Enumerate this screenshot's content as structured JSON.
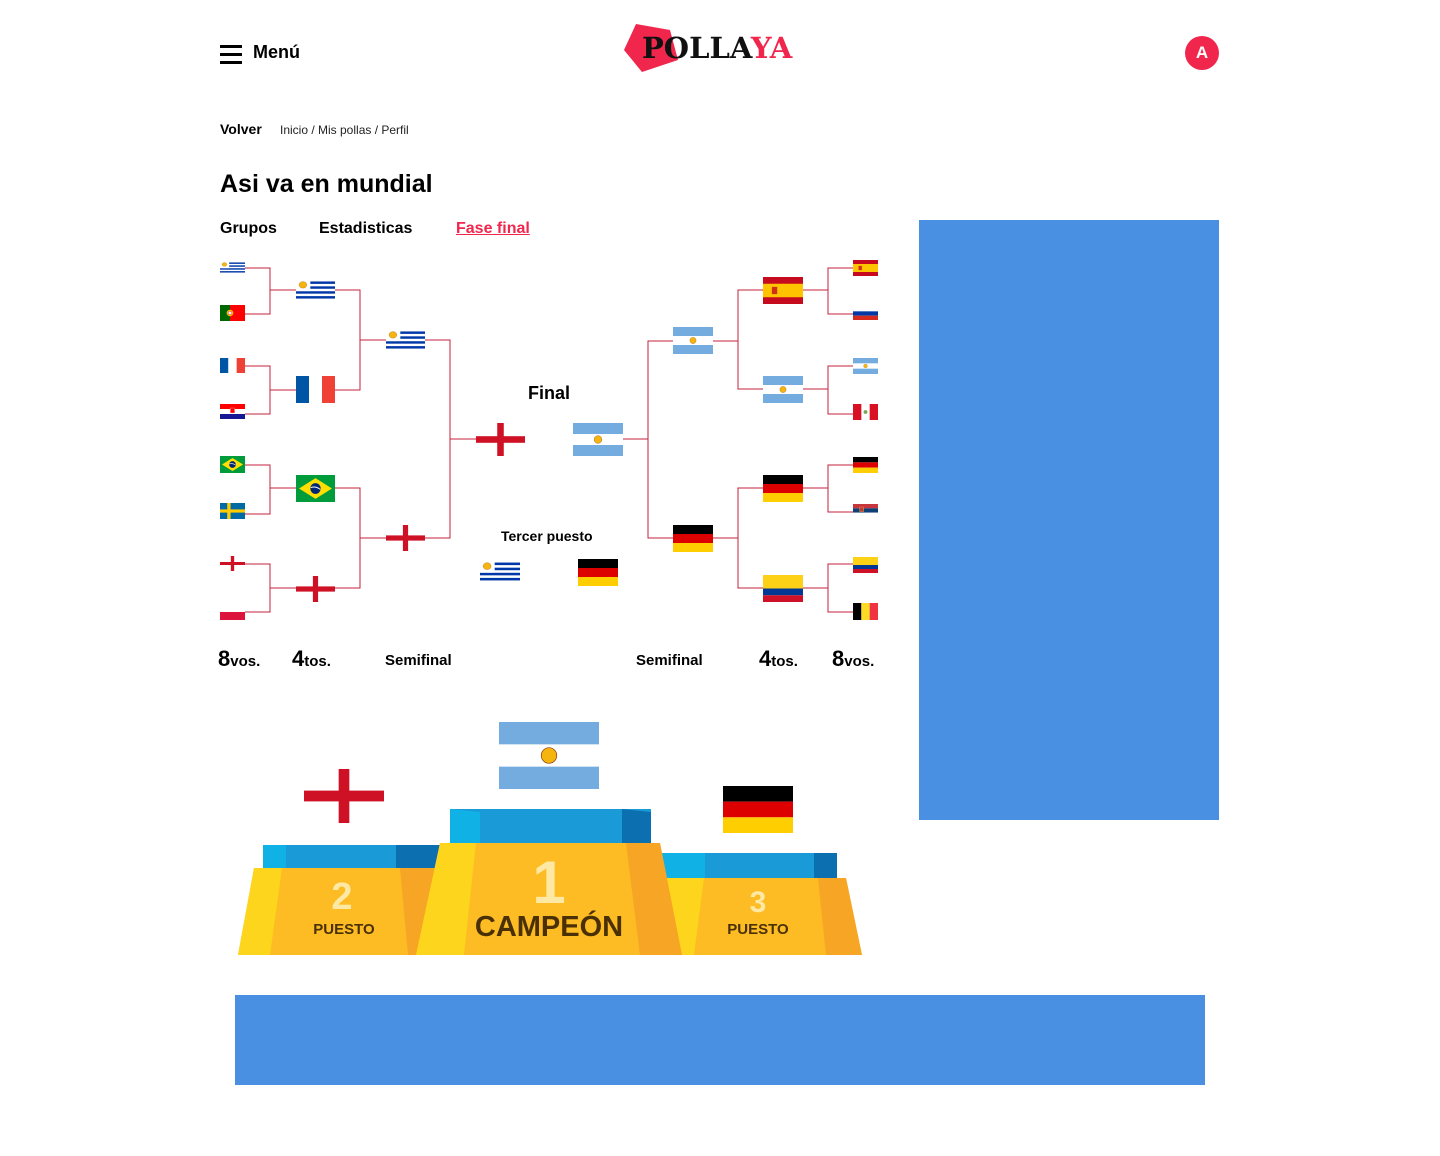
{
  "header": {
    "menu_label": "Menú",
    "logo_part1": "POLLA",
    "logo_part2": "YA",
    "avatar_initial": "A",
    "brand_color": "#f0264d"
  },
  "breadcrumb": {
    "back": "Volver",
    "path": "Inicio / Mis pollas / Perfil"
  },
  "page": {
    "title": "Asi va en mundial"
  },
  "tabs": [
    {
      "label": "Grupos",
      "active": false
    },
    {
      "label": "Estadisticas",
      "active": false
    },
    {
      "label": "Fase final",
      "active": true
    }
  ],
  "bracket": {
    "left_round_of_16": [
      "uruguay",
      "portugal",
      "france",
      "croatia",
      "brazil",
      "sweden",
      "england",
      "poland"
    ],
    "left_quarters": [
      "uruguay",
      "france",
      "brazil",
      "england"
    ],
    "left_semis": [
      "uruguay",
      "england"
    ],
    "final": [
      "england",
      "argentina"
    ],
    "right_semis": [
      "argentina",
      "germany"
    ],
    "right_quarters": [
      "spain",
      "argentina",
      "germany",
      "colombia"
    ],
    "right_round_of_16": [
      "spain",
      "russia",
      "argentina",
      "peru",
      "germany",
      "serbia",
      "colombia",
      "belgium"
    ],
    "third_place": [
      "uruguay",
      "germany"
    ],
    "final_label": "Final",
    "third_place_label": "Tercer puesto",
    "stage_labels": {
      "r16_num": "8",
      "r16_suffix": "vos.",
      "qf_num": "4",
      "qf_suffix": "tos.",
      "semi": "Semifinal"
    }
  },
  "podium": {
    "first": {
      "number": "1",
      "label": "CAMPEÓN",
      "team": "argentina"
    },
    "second": {
      "number": "2",
      "label": "PUESTO",
      "team": "england"
    },
    "third": {
      "number": "3",
      "label": "PUESTO",
      "team": "germany"
    }
  },
  "colors": {
    "ad_blue": "#4a90e2",
    "bracket_line": "#c41f3c",
    "podium_yellow": "#fdbb24",
    "podium_blue": "#1a9ad6"
  }
}
